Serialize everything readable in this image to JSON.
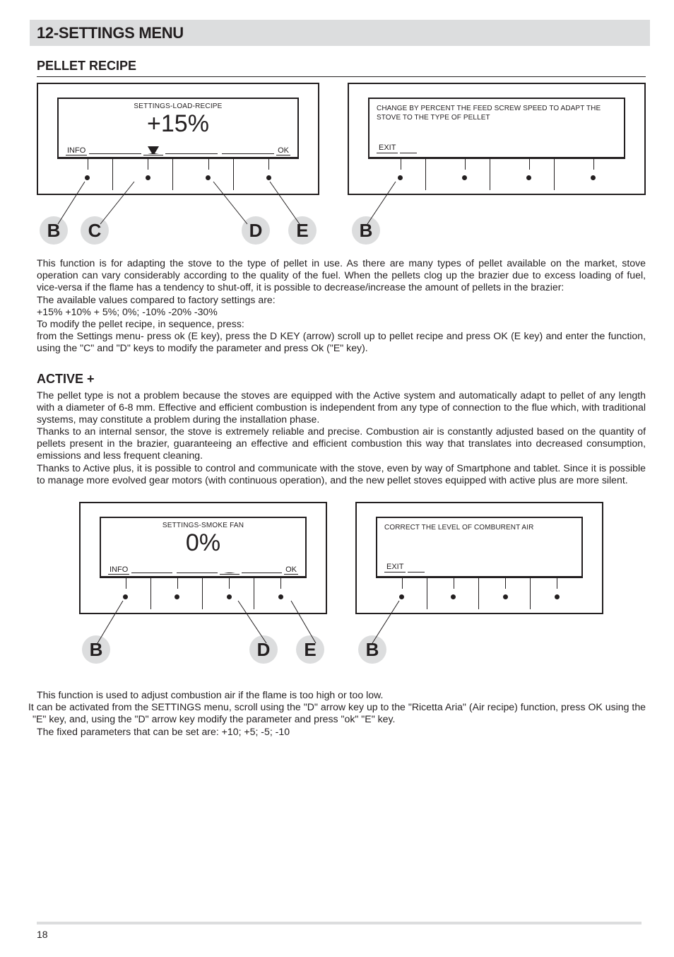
{
  "page_number": "18",
  "header": {
    "title": "12-SETTINGS MENU"
  },
  "section1": {
    "title": "PELLET RECIPE",
    "panel_left": {
      "lcd_title": "SETTINGS-LOAD-RECIPE",
      "lcd_value": "+15%",
      "left_label": "INFO",
      "right_label": "OK"
    },
    "panel_right": {
      "info_text": "CHANGE BY PERCENT THE FEED SCREW SPEED TO ADAPT THE STOVE TO THE TYPE OF PELLET",
      "exit_label": "EXIT"
    },
    "labels": {
      "b": "B",
      "c": "C",
      "d": "D",
      "e": "E",
      "b2": "B"
    },
    "para1": "This function is for adapting the stove to the type of pellet in use. As there are many types of pellet available on the market, stove operation can vary considerably according to the quality of the fuel. When the pellets clog up the brazier due to excess loading of fuel, vice-versa if the flame has a tendency to shut-off, it is possible to decrease/increase the amount of pellets in the brazier:",
    "para2": "The available values compared to factory settings are:",
    "para3": "+15% +10% + 5%; 0%; -10% -20% -30%",
    "para4": "To modify the pellet recipe, in sequence, press:",
    "para5": "from the Settings menu- press ok (E key), press the D KEY (arrow) scroll up to pellet recipe and press OK (E key) and enter the function, using the \"C\" and \"D\" keys to modify the parameter and press Ok (\"E\" key)."
  },
  "section2": {
    "title": "ACTIVE +",
    "para1": "The pellet type is not a problem because the stoves are equipped with the Active system and automatically adapt to pellet of any length with a diameter of 6-8 mm. Effective and efficient combustion is independent from any type of connection to the flue which, with traditional systems, may constitute a problem during the installation phase.",
    "para2": "Thanks to an internal sensor, the stove is extremely reliable and precise. Combustion air is constantly adjusted based on the quantity of pellets present in the brazier, guaranteeing an effective and efficient combustion this way that translates into decreased consumption, emissions and less frequent cleaning.",
    "para3": "Thanks to Active plus, it is possible to control and communicate with the stove, even by way of Smartphone and tablet. Since it is possible to manage more evolved gear motors (with continuous operation), and the new pellet stoves equipped with active plus are more silent.",
    "panel_left": {
      "lcd_title": "SETTINGS-SMOKE FAN",
      "lcd_value": "0%",
      "left_label": "INFO",
      "right_label": "OK"
    },
    "panel_right": {
      "info_text": "CORRECT THE LEVEL OF COMBURENT AIR",
      "exit_label": "EXIT"
    },
    "labels": {
      "b": "B",
      "d": "D",
      "e": "E",
      "b2": "B"
    },
    "para4": "This function is used to adjust combustion air if the flame is too high or too low.",
    "para5": " It can be activated from the SETTINGS menu, scroll using the \"D\" arrow key up to the \"Ricetta Aria\" (Air recipe) function, press OK using the \"E\" key, and, using the \"D\" arrow key modify the parameter and press \"ok\" \"E\" key.",
    "para6": "The fixed parameters that can be set are: +10; +5; -5; -10"
  }
}
